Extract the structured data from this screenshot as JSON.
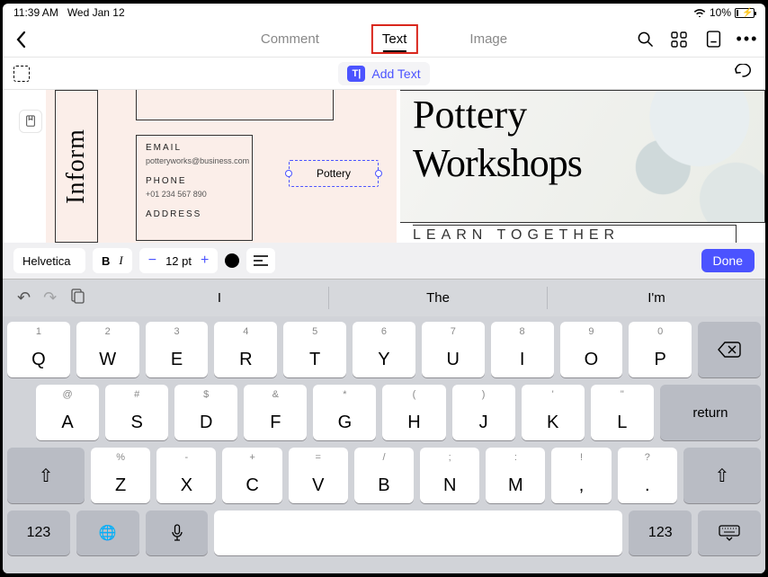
{
  "status": {
    "time": "11:39 AM",
    "date": "Wed Jan 12",
    "battery_pct": "10%"
  },
  "tabs": {
    "comment": "Comment",
    "text": "Text",
    "image": "Image"
  },
  "subbar": {
    "add_text": "Add Text"
  },
  "doc": {
    "inform": "Inform",
    "email_label": "EMAIL",
    "email_value": "potteryworks@business.com",
    "phone_label": "PHONE",
    "phone_value": "+01 234 567 890",
    "address_label": "ADDRESS",
    "textbox_value": "Pottery",
    "headline1": "Pottery",
    "headline2": "Workshops",
    "subhead": "LEARN TOGETHER"
  },
  "fmt": {
    "font": "Helvetica",
    "bold": "B",
    "italic": "I",
    "minus": "−",
    "size": "12 pt",
    "plus": "+",
    "done": "Done"
  },
  "suggestions": {
    "s1": "I",
    "s2": "The",
    "s3": "I'm"
  },
  "keys": {
    "r1h": [
      "1",
      "2",
      "3",
      "4",
      "5",
      "6",
      "7",
      "8",
      "9",
      "0"
    ],
    "r1": [
      "Q",
      "W",
      "E",
      "R",
      "T",
      "Y",
      "U",
      "I",
      "O",
      "P"
    ],
    "r2h": [
      "@",
      "#",
      "$",
      "&",
      "*",
      "(",
      ")",
      "'",
      "\""
    ],
    "r2": [
      "A",
      "S",
      "D",
      "F",
      "G",
      "H",
      "J",
      "K",
      "L"
    ],
    "r3h": [
      "%",
      "-",
      "+",
      "=",
      "/",
      ";",
      ":",
      "!",
      "?"
    ],
    "r3": [
      "Z",
      "X",
      "C",
      "V",
      "B",
      "N",
      "M",
      ",",
      "."
    ],
    "return": "return",
    "num": "123"
  }
}
